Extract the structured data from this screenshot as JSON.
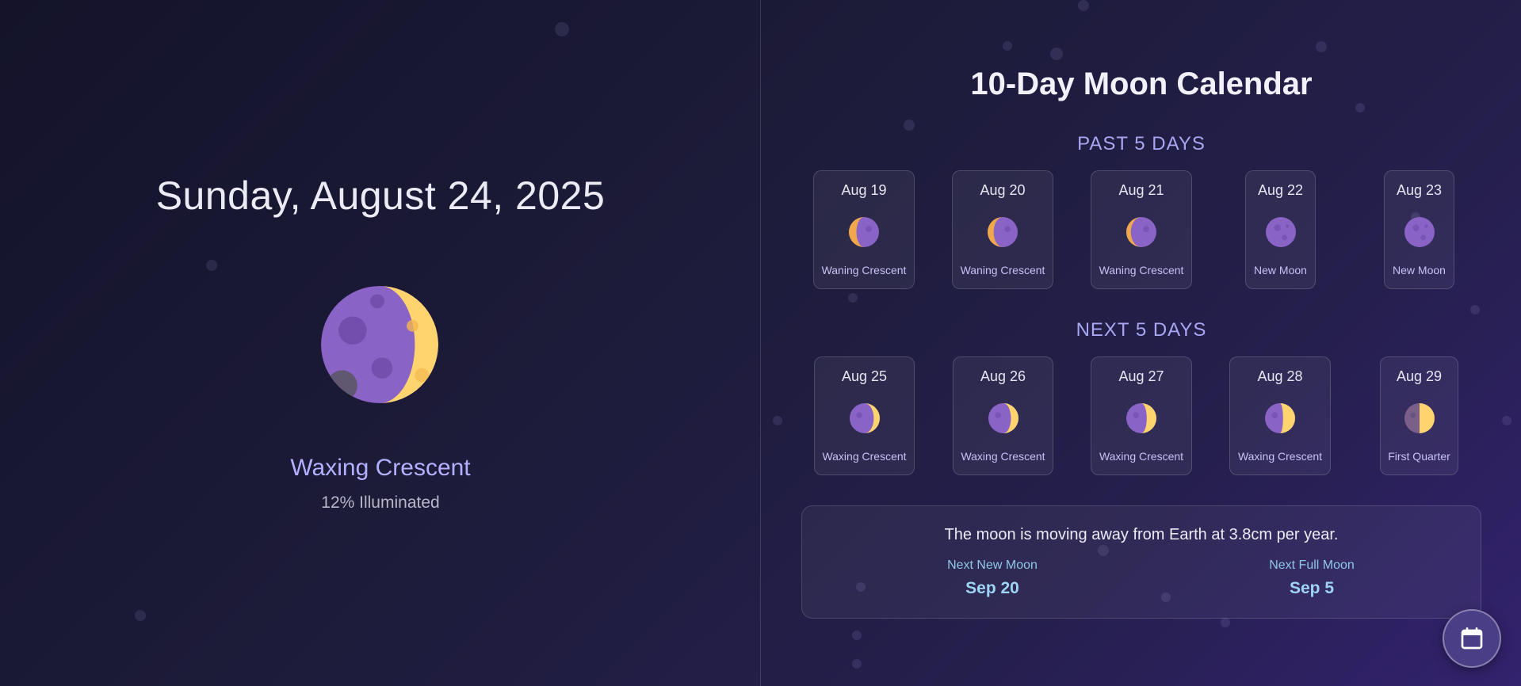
{
  "current": {
    "date": "Sunday, August 24, 2025",
    "phase": "Waxing Crescent",
    "illumination": "12% Illuminated",
    "illumination_fraction": 0.12
  },
  "calendar": {
    "title": "10-Day Moon Calendar",
    "past_label": "PAST 5 DAYS",
    "next_label": "NEXT 5 DAYS",
    "past": [
      {
        "date": "Aug 19",
        "phase": "Waning Crescent"
      },
      {
        "date": "Aug 20",
        "phase": "Waning Crescent"
      },
      {
        "date": "Aug 21",
        "phase": "Waning Crescent"
      },
      {
        "date": "Aug 22",
        "phase": "New Moon"
      },
      {
        "date": "Aug 23",
        "phase": "New Moon"
      }
    ],
    "next": [
      {
        "date": "Aug 25",
        "phase": "Waxing Crescent"
      },
      {
        "date": "Aug 26",
        "phase": "Waxing Crescent"
      },
      {
        "date": "Aug 27",
        "phase": "Waxing Crescent"
      },
      {
        "date": "Aug 28",
        "phase": "Waxing Crescent"
      },
      {
        "date": "Aug 29",
        "phase": "First Quarter"
      }
    ]
  },
  "info": {
    "fact": "The moon is moving away from Earth at 3.8cm per year.",
    "next_new_moon_label": "Next New Moon",
    "next_new_moon": "Sep 20",
    "next_full_moon_label": "Next Full Moon",
    "next_full_moon": "Sep 5"
  },
  "icons": {
    "calendar_button": "calendar-icon",
    "moon": "moon-phase-icon"
  },
  "colors": {
    "moon_dark": "#8a63c6",
    "moon_lit": "#ffd36e",
    "accent": "#b3b0ff",
    "info_accent": "#9ed4f5"
  }
}
